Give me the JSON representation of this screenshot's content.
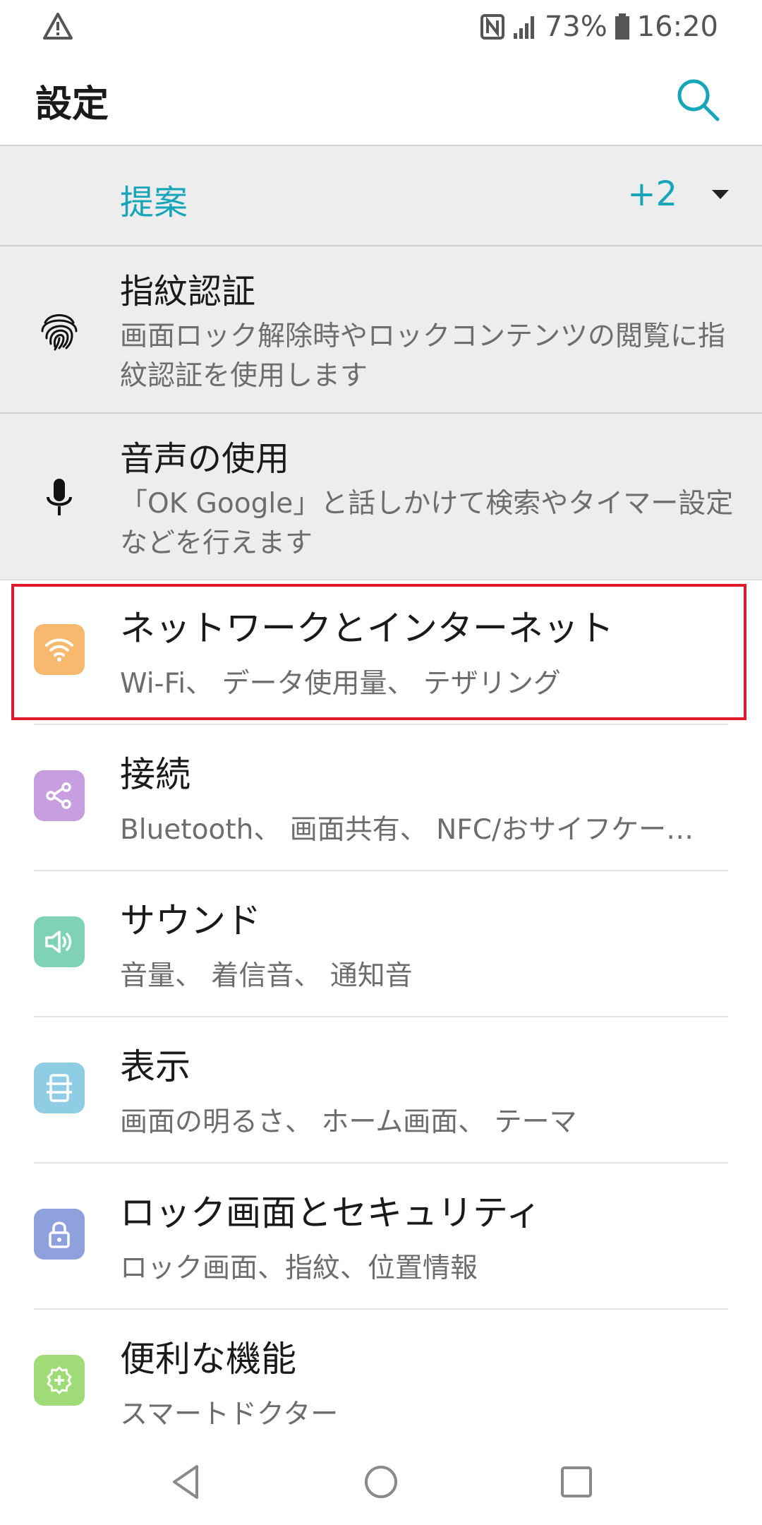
{
  "status_bar": {
    "battery": "73%",
    "time": "16:20",
    "icons": [
      "warning-icon",
      "nfc-icon",
      "signal-icon",
      "battery-icon"
    ]
  },
  "header": {
    "title": "設定",
    "search_icon": "search-icon"
  },
  "suggestions": {
    "title": "提案",
    "count": "+2",
    "items": [
      {
        "title": "指紋認証",
        "desc": "画面ロック解除時やロックコンテンツの閲覧に指紋認証を使用します",
        "icon": "fingerprint-icon"
      },
      {
        "title": "音声の使用",
        "desc": "「OK Google」と話しかけて検索やタイマー設定などを行えます",
        "icon": "microphone-icon"
      }
    ]
  },
  "settings": [
    {
      "title": "ネットワークとインターネット",
      "desc": "Wi-Fi、 データ使用量、 テザリング",
      "icon": "wifi-icon",
      "color": "#f7b96e"
    },
    {
      "title": "接続",
      "desc": "Bluetooth、 画面共有、 NFC/おサイフケー…",
      "icon": "share-icon",
      "color": "#c79ee0"
    },
    {
      "title": "サウンド",
      "desc": "音量、 着信音、 通知音",
      "icon": "speaker-icon",
      "color": "#7fd2b7"
    },
    {
      "title": "表示",
      "desc": "画面の明るさ、 ホーム画面、 テーマ",
      "icon": "display-icon",
      "color": "#8fcde5"
    },
    {
      "title": "ロック画面とセキュリティ",
      "desc": "ロック画面、指紋、位置情報",
      "icon": "lock-icon",
      "color": "#8fa1dc"
    },
    {
      "title": "便利な機能",
      "desc": "スマートドクター",
      "icon": "gear-plus-icon",
      "color": "#9fdb76"
    }
  ],
  "highlight_color": "#e01a2b",
  "accent_color": "#17a5b9",
  "nav_bar": [
    "back-icon",
    "home-icon",
    "recents-icon"
  ]
}
